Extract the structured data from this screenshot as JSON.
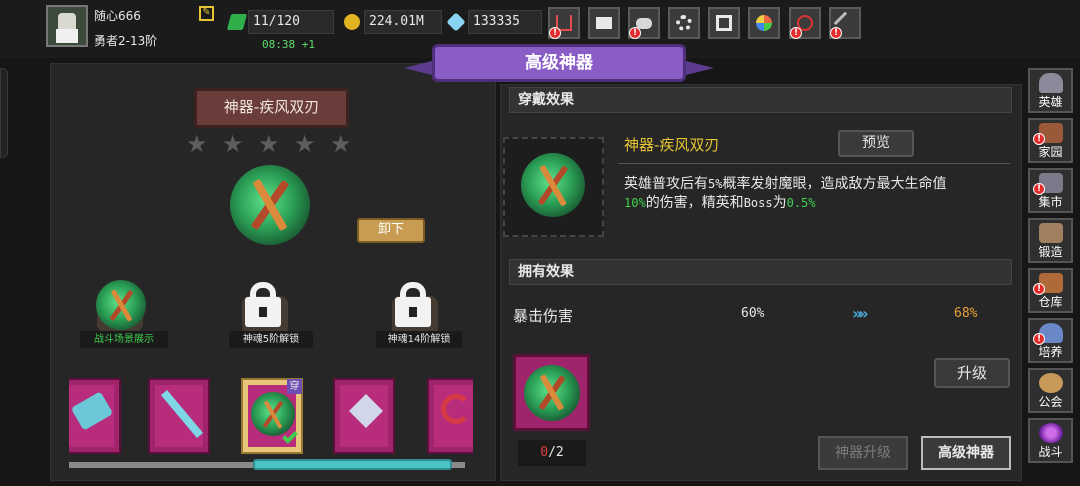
{
  "player": {
    "name": "随心666",
    "rank": "勇者2-13阶"
  },
  "resources": {
    "energy": "11/120",
    "energy_timer": "08:38 +1",
    "gold": "224.01M",
    "diamonds": "133335"
  },
  "top_icons": [
    "shop-cart-icon",
    "mail-icon",
    "gamepad-icon",
    "gear-icon",
    "gift-icon",
    "wheel-icon",
    "event-icon",
    "swords-icon"
  ],
  "banner_title": "高级神器",
  "artifact": {
    "name": "神器-疾风双刃",
    "stars": [
      "★",
      "★",
      "★",
      "★",
      "★"
    ],
    "unload_label": "卸下"
  },
  "slots": [
    {
      "label": "战斗场景展示"
    },
    {
      "label": "神魂5阶解锁"
    },
    {
      "label": "神魂14阶解锁"
    }
  ],
  "equipped_badge": "穿",
  "sections": {
    "equip_effect": "穿戴效果",
    "own_effect": "拥有效果"
  },
  "equip_effect": {
    "name": "神器-疾风双刃",
    "preview_label": "预览",
    "desc_1": "英雄普攻后有",
    "desc_2": "5%",
    "desc_3": "概率发射魔眼，造成敌方最大生命值",
    "desc_4": "10%",
    "desc_5": "的伤害，精英和",
    "desc_6": "Boss",
    "desc_7": "为",
    "desc_8": "0.5%"
  },
  "own_effect": {
    "stat_name": "暴击伤害",
    "current": "60%",
    "next": "68%",
    "arrows": "»»"
  },
  "material": {
    "have": "0",
    "need": "/2"
  },
  "buttons": {
    "upgrade": "升级",
    "artifact_upgrade": "神器升级",
    "advanced_artifact": "高级神器"
  },
  "sidebar": [
    {
      "label": "英雄",
      "icon": "helmet-icon"
    },
    {
      "label": "家园",
      "icon": "castle-icon"
    },
    {
      "label": "集市",
      "icon": "market-icon"
    },
    {
      "label": "锻造",
      "icon": "anvil-icon"
    },
    {
      "label": "仓库",
      "icon": "warehouse-icon"
    },
    {
      "label": "培养",
      "icon": "potion-icon"
    },
    {
      "label": "公会",
      "icon": "guild-icon"
    },
    {
      "label": "战斗",
      "icon": "portal-icon"
    }
  ],
  "colors": {
    "accent_gold": "#e6c531",
    "highlight_green": "#3fd14e",
    "banner_purple": "#8a5cc6",
    "item_magenta": "#a0246b",
    "progress_cyan": "#4bc4c8"
  },
  "scroll_progress": 0.5
}
